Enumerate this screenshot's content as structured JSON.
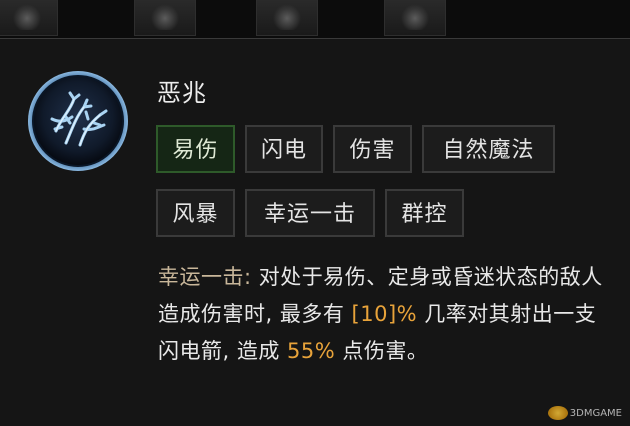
{
  "skill": {
    "name": "恶兆",
    "icon": "thorn-rune-icon"
  },
  "tags": [
    {
      "label": "易伤",
      "active": true
    },
    {
      "label": "闪电",
      "active": false
    },
    {
      "label": "伤害",
      "active": false
    },
    {
      "label": "自然魔法",
      "active": false
    },
    {
      "label": "风暴",
      "active": false
    },
    {
      "label": "幸运一击",
      "active": false
    },
    {
      "label": "群控",
      "active": false
    }
  ],
  "description": {
    "keyword": "幸运一击:",
    "text_1": " 对处于易伤、定身或昏迷状态的敌人造成伤害时, 最多有 ",
    "chance": "[10]%",
    "text_2": " 几率对其射出一支 闪电箭, 造成 ",
    "damage": "55%",
    "text_3": " 点伤害。"
  },
  "watermark": "3DMGAME",
  "colors": {
    "active_tag_bg": "#152615",
    "active_tag_border": "#2e5a2a",
    "keyword": "#c9b79a",
    "highlight_number": "#e8a33a"
  }
}
